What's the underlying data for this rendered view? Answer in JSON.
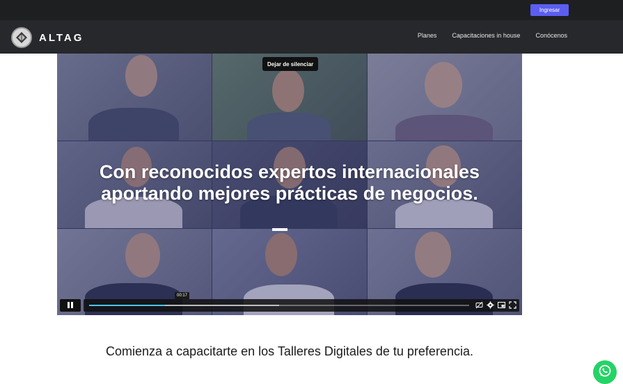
{
  "topbar": {
    "login_label": "Ingresar"
  },
  "brand": {
    "name": "ALTAG",
    "logo_icon": "altag-logo-icon"
  },
  "nav": {
    "items": [
      "Planes",
      "Capacitaciones in house",
      "Conócenos"
    ]
  },
  "video": {
    "mute_label": "Dejar de silenciar",
    "headline_line1": "Con reconocidos expertos internacionales",
    "headline_line2": "aportando mejores prácticas de negocios.",
    "current_time": "00:17",
    "progress": 0.2,
    "buffered": 0.5,
    "icons": {
      "play_pause": "pause-icon",
      "captions": "captions-off-icon",
      "settings": "gear-icon",
      "pip": "picture-in-picture-icon",
      "fullscreen": "fullscreen-icon"
    }
  },
  "tagline": "Comienza a capacitarte en los Talleres Digitales de tu preferencia.",
  "whatsapp": {
    "icon": "whatsapp-icon",
    "color": "#25d366"
  },
  "colors": {
    "accent": "#5b5ef0",
    "progress": "#4fc3e9"
  }
}
